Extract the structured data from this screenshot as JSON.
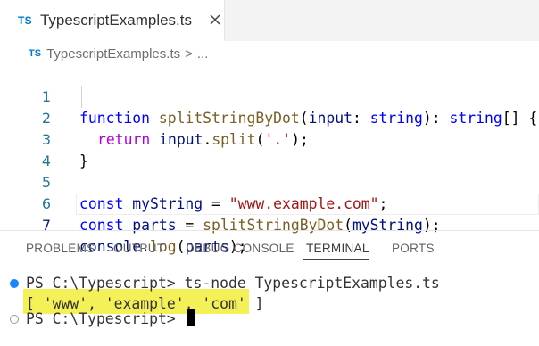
{
  "tab": {
    "badge": "TS",
    "label": "TypescriptExamples.ts"
  },
  "breadcrumb": {
    "badge": "TS",
    "file": "TypescriptExamples.ts",
    "separator": ">",
    "more": "..."
  },
  "editor": {
    "lines": [
      {
        "number": "1"
      },
      {
        "number": "2"
      },
      {
        "number": "3"
      },
      {
        "number": "4"
      },
      {
        "number": "5"
      },
      {
        "number": "6"
      },
      {
        "number": "7"
      }
    ],
    "code": {
      "l1": {
        "kw": "function",
        "fn": "splitStringByDot",
        "p1": "(",
        "param": "input",
        "p2": ": ",
        "t1": "string",
        "p3": "): ",
        "t2": "string",
        "p4": "[] {"
      },
      "l2": {
        "ret": "return",
        "var": "input",
        "dot": ".",
        "fn": "split",
        "p1": "(",
        "str": "'.'",
        "p2": ");"
      },
      "l3": {
        "brace": "}"
      },
      "l5": {
        "kw": "const",
        "var": "myString",
        "eq": " = ",
        "str": "\"www.example.com\"",
        "end": ";"
      },
      "l6": {
        "kw": "const",
        "var": "parts",
        "eq": " = ",
        "fn": "splitStringByDot",
        "p1": "(",
        "arg": "myString",
        "p2": ");"
      },
      "l7": {
        "obj": "console",
        "dot": ".",
        "fn": "log",
        "p1": "(",
        "arg": "parts",
        "p2": ");"
      }
    }
  },
  "panel": {
    "tabs": [
      "PROBLEMS",
      "OUTPUT",
      "DEBUG CONSOLE",
      "TERMINAL",
      "PORTS"
    ],
    "active_tab": "TERMINAL"
  },
  "terminal": {
    "line1": "PS C:\\Typescript> ts-node TypescriptExamples.ts",
    "line2": "[ 'www', 'example', 'com' ]",
    "line3": "PS C:\\Typescript> "
  },
  "colors": {
    "accent": "#007acc",
    "highlight": "#f1ed3b",
    "success_dot": "#1a85ff"
  }
}
